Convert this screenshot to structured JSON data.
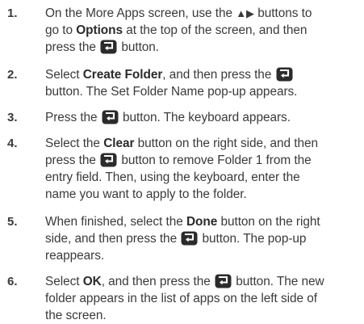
{
  "icons": {
    "enter_button": "enter-return-icon"
  },
  "colors": {
    "text": "#3a3a3a",
    "icon_bg": "#2b2b2b",
    "icon_fg": "#ffffff"
  },
  "steps": [
    {
      "number": "1.",
      "lines": [
        {
          "a": "On the More Apps screen, use the ",
          "arrows": "▲▶",
          "b": " buttons to"
        },
        {
          "a": "go to ",
          "bold": "Options",
          "b": " at the top of the screen, and then"
        },
        {
          "a": "press the ",
          "b": " button."
        }
      ]
    },
    {
      "number": "2.",
      "lines": [
        {
          "a": "Select ",
          "bold": "Create Folder",
          "b": ", and then press the "
        },
        {
          "a": "button. The Set Folder Name pop-up appears."
        }
      ]
    },
    {
      "number": "3.",
      "lines": [
        {
          "a": "Press the ",
          "b": " button. The keyboard appears."
        }
      ]
    },
    {
      "number": "4.",
      "lines": [
        {
          "a": "Select the ",
          "bold": "Clear",
          "b": " button on the right side, and then"
        },
        {
          "a": "press the ",
          "b": " button to remove Folder 1 from the"
        },
        {
          "a": "entry field. Then, using the keyboard, enter the"
        },
        {
          "a": "name you want to apply to the folder."
        }
      ]
    },
    {
      "number": "5.",
      "lines": [
        {
          "a": "When finished, select the ",
          "bold": "Done",
          "b": " button on the right"
        },
        {
          "a": "side, and then press the ",
          "b": " button. The pop-up"
        },
        {
          "a": "reappears."
        }
      ]
    },
    {
      "number": "6.",
      "lines": [
        {
          "a": "Select ",
          "bold": "OK",
          "b": ", and then press the ",
          "c": " button. The new"
        },
        {
          "a": "folder appears in the list of apps on the left side of"
        },
        {
          "a": "the screen."
        }
      ]
    }
  ]
}
